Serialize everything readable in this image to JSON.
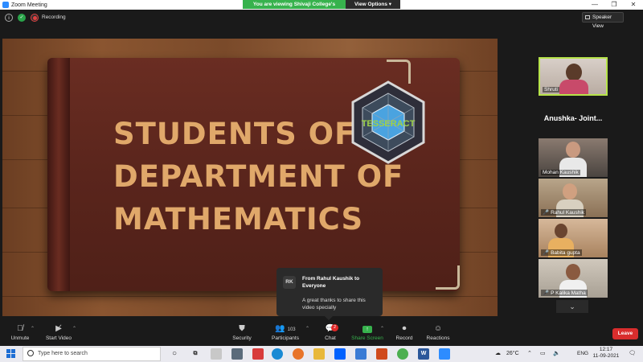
{
  "window": {
    "title": "Zoom Meeting",
    "controls": [
      "—",
      "❐",
      "✕"
    ]
  },
  "share_banner": {
    "message": "You are viewing Shivaji College's screen",
    "options_label": "View Options ▾"
  },
  "status": {
    "recording_label": "Recording"
  },
  "view_button": {
    "label": "Speaker View"
  },
  "slide": {
    "title_lines": [
      "STUDENTS OF",
      "DEPARTMENT OF",
      "MATHEMATICS"
    ],
    "logo_text": "TESSERACT"
  },
  "participants": [
    {
      "name": "Shruti",
      "muted": false,
      "active": true,
      "bg": "#c9c0b8"
    },
    {
      "name": "Anushka-  Joint...",
      "video": false
    },
    {
      "name": "Mohan Kaushik",
      "muted": false,
      "bg": "#6b6b6b"
    },
    {
      "name": "Rahul Kaushik",
      "muted": true,
      "bg": "#a08a70"
    },
    {
      "name": "Babita gupta",
      "muted": true,
      "bg": "#c4a383"
    },
    {
      "name": "P Kalika Matha",
      "muted": true,
      "bg": "#bcb5aa"
    }
  ],
  "chat_notification": {
    "initials": "RK",
    "from": "From Rahul Kaushik to Everyone",
    "message": "A great thanks to share this video specially"
  },
  "toolbar": {
    "unmute": "Unmute",
    "start_video": "Start Video",
    "security": "Security",
    "participants": "Participants",
    "participants_count": "103",
    "chat": "Chat",
    "chat_badge": "2",
    "share_screen": "Share Screen",
    "record": "Record",
    "reactions": "Reactions",
    "leave": "Leave"
  },
  "taskbar": {
    "search_placeholder": "Type here to search",
    "weather": "26°C",
    "language": "ENG",
    "time": "12:17",
    "date": "11-09-2021"
  },
  "colors": {
    "accent_green": "#37b24d",
    "leave_red": "#d92d2d",
    "slide_title": "#e0a86a"
  }
}
